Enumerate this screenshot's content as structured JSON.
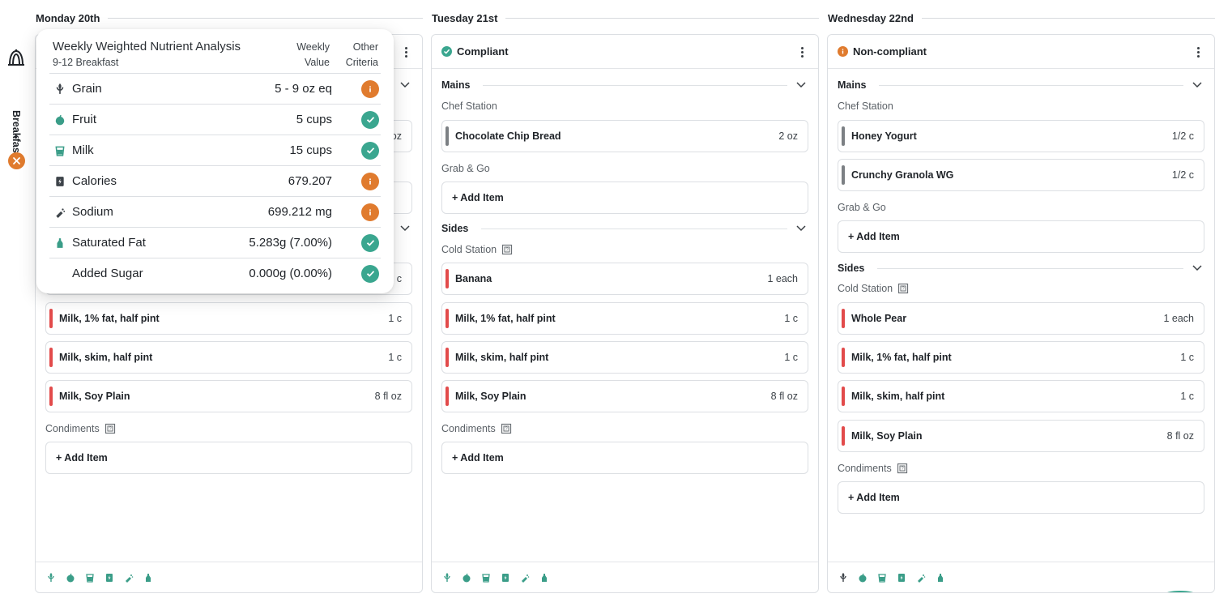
{
  "meal": {
    "label": "Breakfast"
  },
  "colors": {
    "ok": "#3aa68f",
    "warn": "#e07b2e",
    "bar_red": "#e24b4b",
    "bar_gray": "#7c8084",
    "nutrient_icon": "#3a9d88"
  },
  "nutrient_icons": [
    "grain-icon",
    "fruit-icon",
    "milk-icon",
    "calories-icon",
    "sodium-icon",
    "saturated-fat-icon"
  ],
  "days": [
    {
      "title": "Monday 20th",
      "status": "",
      "status_type": "none",
      "visible_items": [
        {
          "qty": "oz"
        },
        {
          "qty": "c"
        },
        {
          "name": "Milk, 1% fat, half pint",
          "qty": "1 c"
        },
        {
          "name": "Milk, skim, half pint",
          "qty": "1 c"
        },
        {
          "name": "Milk, Soy Plain",
          "qty": "8 fl oz"
        }
      ],
      "condiments": {
        "title": "Condiments",
        "add_label": "+ Add Item"
      }
    },
    {
      "title": "Tuesday 21st",
      "status": "Compliant",
      "status_type": "ok",
      "mains": {
        "title": "Mains",
        "chef_station": "Chef Station",
        "items": [
          {
            "name": "Chocolate Chip Bread",
            "qty": "2 oz"
          }
        ],
        "grab_go": "Grab & Go",
        "add_label": "+ Add Item"
      },
      "sides": {
        "title": "Sides",
        "cold_station": "Cold Station",
        "items": [
          {
            "name": "Banana",
            "qty": "1 each"
          },
          {
            "name": "Milk, 1% fat, half pint",
            "qty": "1 c"
          },
          {
            "name": "Milk, skim, half pint",
            "qty": "1 c"
          },
          {
            "name": "Milk, Soy Plain",
            "qty": "8 fl oz"
          }
        ]
      },
      "condiments": {
        "title": "Condiments",
        "add_label": "+ Add Item"
      }
    },
    {
      "title": "Wednesday 22nd",
      "status": "Non-compliant",
      "status_type": "warn",
      "mains": {
        "title": "Mains",
        "chef_station": "Chef Station",
        "items": [
          {
            "name": "Honey Yogurt",
            "qty": "1/2 c"
          },
          {
            "name": "Crunchy Granola WG",
            "qty": "1/2 c"
          }
        ],
        "grab_go": "Grab & Go",
        "add_label": "+ Add Item"
      },
      "sides": {
        "title": "Sides",
        "cold_station": "Cold Station",
        "items": [
          {
            "name": "Whole Pear",
            "qty": "1 each"
          },
          {
            "name": "Milk, 1% fat, half pint",
            "qty": "1 c"
          },
          {
            "name": "Milk, skim, half pint",
            "qty": "1 c"
          },
          {
            "name": "Milk, Soy Plain",
            "qty": "8 fl oz"
          }
        ]
      },
      "condiments": {
        "title": "Condiments",
        "add_label": "+ Add Item"
      }
    }
  ],
  "popover": {
    "title": "Weekly Weighted Nutrient Analysis",
    "subtitle": "9-12 Breakfast",
    "col_value_line1": "Weekly",
    "col_value_line2": "Value",
    "col_other_line1": "Other",
    "col_other_line2": "Criteria",
    "rows": [
      {
        "name": "Grain",
        "value": "5 - 9 oz eq",
        "status": "warn",
        "icon": "grain-icon"
      },
      {
        "name": "Fruit",
        "value": "5 cups",
        "status": "ok",
        "icon": "fruit-icon"
      },
      {
        "name": "Milk",
        "value": "15 cups",
        "status": "ok",
        "icon": "milk-icon"
      },
      {
        "name": "Calories",
        "value": "679.207",
        "status": "warn",
        "icon": "calories-icon"
      },
      {
        "name": "Sodium",
        "value": "699.212 mg",
        "status": "warn",
        "icon": "sodium-icon"
      },
      {
        "name": "Saturated Fat",
        "value": "5.283g (7.00%)",
        "status": "ok",
        "icon": "saturated-fat-icon"
      },
      {
        "name": "Added Sugar",
        "value": "0.000g (0.00%)",
        "status": "ok",
        "icon": ""
      }
    ]
  }
}
